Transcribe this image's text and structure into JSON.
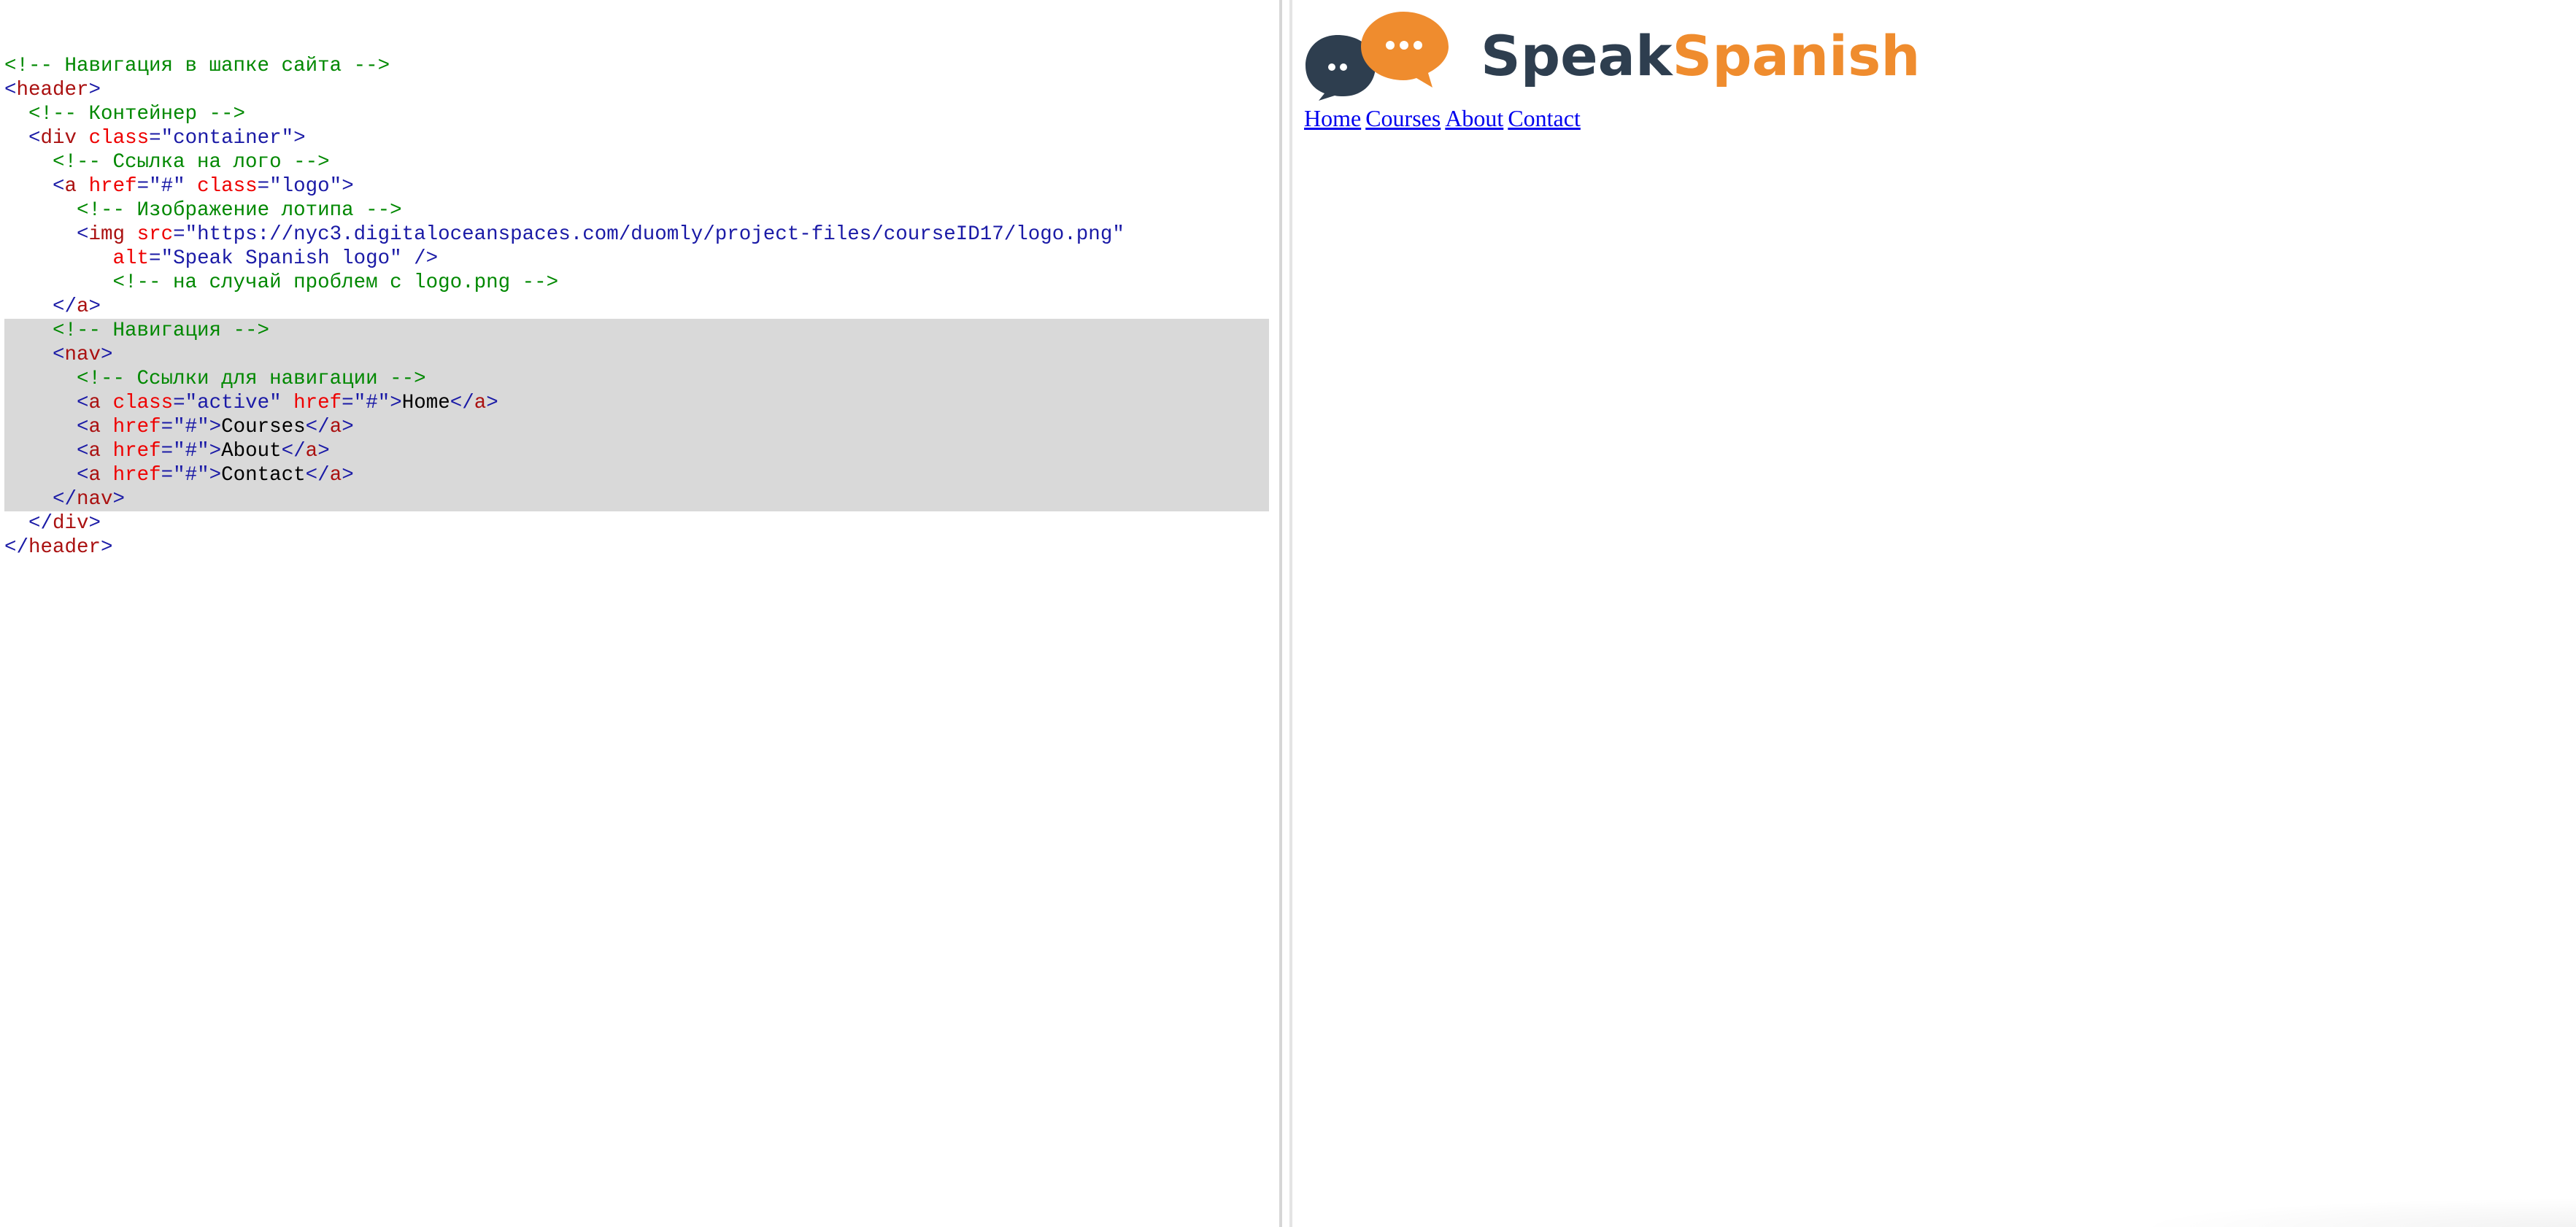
{
  "editor": {
    "lines": [
      {
        "highlight": false,
        "tokens": []
      },
      {
        "highlight": false,
        "tokens": [
          {
            "t": "com",
            "v": "<!-- Навигация в шапке сайта -->"
          }
        ]
      },
      {
        "highlight": false,
        "tokens": [
          {
            "t": "tag",
            "v": "<"
          },
          {
            "t": "name",
            "v": "header"
          },
          {
            "t": "tag",
            "v": ">"
          }
        ]
      },
      {
        "highlight": false,
        "tokens": [
          {
            "t": "txt",
            "v": "  "
          },
          {
            "t": "com",
            "v": "<!-- Контейнер -->"
          }
        ]
      },
      {
        "highlight": false,
        "tokens": [
          {
            "t": "txt",
            "v": "  "
          },
          {
            "t": "tag",
            "v": "<"
          },
          {
            "t": "name",
            "v": "div"
          },
          {
            "t": "txt",
            "v": " "
          },
          {
            "t": "attr",
            "v": "class"
          },
          {
            "t": "tag",
            "v": "="
          },
          {
            "t": "str",
            "v": "\"container\""
          },
          {
            "t": "tag",
            "v": ">"
          }
        ]
      },
      {
        "highlight": false,
        "tokens": [
          {
            "t": "txt",
            "v": "    "
          },
          {
            "t": "com",
            "v": "<!-- Ссылка на лого -->"
          }
        ]
      },
      {
        "highlight": false,
        "tokens": [
          {
            "t": "txt",
            "v": "    "
          },
          {
            "t": "tag",
            "v": "<"
          },
          {
            "t": "name",
            "v": "a"
          },
          {
            "t": "txt",
            "v": " "
          },
          {
            "t": "attr",
            "v": "href"
          },
          {
            "t": "tag",
            "v": "="
          },
          {
            "t": "str",
            "v": "\"#\""
          },
          {
            "t": "txt",
            "v": " "
          },
          {
            "t": "attr",
            "v": "class"
          },
          {
            "t": "tag",
            "v": "="
          },
          {
            "t": "str",
            "v": "\"logo\""
          },
          {
            "t": "tag",
            "v": ">"
          }
        ]
      },
      {
        "highlight": false,
        "tokens": [
          {
            "t": "txt",
            "v": "      "
          },
          {
            "t": "com",
            "v": "<!-- Изображение лотипа -->"
          }
        ]
      },
      {
        "highlight": false,
        "tokens": [
          {
            "t": "txt",
            "v": "      "
          },
          {
            "t": "tag",
            "v": "<"
          },
          {
            "t": "name",
            "v": "img"
          },
          {
            "t": "txt",
            "v": " "
          },
          {
            "t": "attr",
            "v": "src"
          },
          {
            "t": "tag",
            "v": "="
          },
          {
            "t": "str",
            "v": "\"https://nyc3.digitaloceanspaces.com/duomly/project-files/courseID17/logo.png\""
          }
        ]
      },
      {
        "highlight": false,
        "tokens": [
          {
            "t": "txt",
            "v": "         "
          },
          {
            "t": "attr",
            "v": "alt"
          },
          {
            "t": "tag",
            "v": "="
          },
          {
            "t": "str",
            "v": "\"Speak Spanish logo\""
          },
          {
            "t": "txt",
            "v": " "
          },
          {
            "t": "tag",
            "v": "/>"
          }
        ]
      },
      {
        "highlight": false,
        "tokens": [
          {
            "t": "txt",
            "v": "         "
          },
          {
            "t": "com",
            "v": "<!-- на случай проблем с logo.png -->"
          }
        ]
      },
      {
        "highlight": false,
        "tokens": [
          {
            "t": "txt",
            "v": "    "
          },
          {
            "t": "tag",
            "v": "</"
          },
          {
            "t": "name",
            "v": "a"
          },
          {
            "t": "tag",
            "v": ">"
          }
        ]
      },
      {
        "highlight": true,
        "tokens": [
          {
            "t": "txt",
            "v": "    "
          },
          {
            "t": "com",
            "v": "<!-- Навигация -->"
          }
        ]
      },
      {
        "highlight": true,
        "tokens": [
          {
            "t": "txt",
            "v": "    "
          },
          {
            "t": "tag",
            "v": "<"
          },
          {
            "t": "name",
            "v": "nav"
          },
          {
            "t": "tag",
            "v": ">"
          }
        ]
      },
      {
        "highlight": true,
        "tokens": [
          {
            "t": "txt",
            "v": "      "
          },
          {
            "t": "com",
            "v": "<!-- Ссылки для навигации -->"
          }
        ]
      },
      {
        "highlight": true,
        "tokens": [
          {
            "t": "txt",
            "v": "      "
          },
          {
            "t": "tag",
            "v": "<"
          },
          {
            "t": "name",
            "v": "a"
          },
          {
            "t": "txt",
            "v": " "
          },
          {
            "t": "attr",
            "v": "class"
          },
          {
            "t": "tag",
            "v": "="
          },
          {
            "t": "str",
            "v": "\"active\""
          },
          {
            "t": "txt",
            "v": " "
          },
          {
            "t": "attr",
            "v": "href"
          },
          {
            "t": "tag",
            "v": "="
          },
          {
            "t": "str",
            "v": "\"#\""
          },
          {
            "t": "tag",
            "v": ">"
          },
          {
            "t": "txt",
            "v": "Home"
          },
          {
            "t": "tag",
            "v": "</"
          },
          {
            "t": "name",
            "v": "a"
          },
          {
            "t": "tag",
            "v": ">"
          }
        ]
      },
      {
        "highlight": true,
        "tokens": [
          {
            "t": "txt",
            "v": "      "
          },
          {
            "t": "tag",
            "v": "<"
          },
          {
            "t": "name",
            "v": "a"
          },
          {
            "t": "txt",
            "v": " "
          },
          {
            "t": "attr",
            "v": "href"
          },
          {
            "t": "tag",
            "v": "="
          },
          {
            "t": "str",
            "v": "\"#\""
          },
          {
            "t": "tag",
            "v": ">"
          },
          {
            "t": "txt",
            "v": "Courses"
          },
          {
            "t": "tag",
            "v": "</"
          },
          {
            "t": "name",
            "v": "a"
          },
          {
            "t": "tag",
            "v": ">"
          }
        ]
      },
      {
        "highlight": true,
        "tokens": [
          {
            "t": "txt",
            "v": "      "
          },
          {
            "t": "tag",
            "v": "<"
          },
          {
            "t": "name",
            "v": "a"
          },
          {
            "t": "txt",
            "v": " "
          },
          {
            "t": "attr",
            "v": "href"
          },
          {
            "t": "tag",
            "v": "="
          },
          {
            "t": "str",
            "v": "\"#\""
          },
          {
            "t": "tag",
            "v": ">"
          },
          {
            "t": "txt",
            "v": "About"
          },
          {
            "t": "tag",
            "v": "</"
          },
          {
            "t": "name",
            "v": "a"
          },
          {
            "t": "tag",
            "v": ">"
          }
        ]
      },
      {
        "highlight": true,
        "tokens": [
          {
            "t": "txt",
            "v": "      "
          },
          {
            "t": "tag",
            "v": "<"
          },
          {
            "t": "name",
            "v": "a"
          },
          {
            "t": "txt",
            "v": " "
          },
          {
            "t": "attr",
            "v": "href"
          },
          {
            "t": "tag",
            "v": "="
          },
          {
            "t": "str",
            "v": "\"#\""
          },
          {
            "t": "tag",
            "v": ">"
          },
          {
            "t": "txt",
            "v": "Contact"
          },
          {
            "t": "tag",
            "v": "</"
          },
          {
            "t": "name",
            "v": "a"
          },
          {
            "t": "tag",
            "v": ">"
          }
        ]
      },
      {
        "highlight": true,
        "tokens": [
          {
            "t": "txt",
            "v": "    "
          },
          {
            "t": "tag",
            "v": "</"
          },
          {
            "t": "name",
            "v": "nav"
          },
          {
            "t": "tag",
            "v": ">"
          }
        ]
      },
      {
        "highlight": false,
        "tokens": [
          {
            "t": "txt",
            "v": "  "
          },
          {
            "t": "tag",
            "v": "</"
          },
          {
            "t": "name",
            "v": "div"
          },
          {
            "t": "tag",
            "v": ">"
          }
        ]
      },
      {
        "highlight": false,
        "tokens": [
          {
            "t": "tag",
            "v": "</"
          },
          {
            "t": "name",
            "v": "header"
          },
          {
            "t": "tag",
            "v": ">"
          }
        ]
      }
    ]
  },
  "preview": {
    "logo": {
      "alt": "Speak Spanish logo",
      "word_1": "Speak",
      "word_2": "Spanish",
      "color_dark": "#2e3e4f",
      "color_orange": "#ef8c2e",
      "icon": "chat-bubbles-icon"
    },
    "nav": [
      {
        "label": "Home",
        "active": true
      },
      {
        "label": "Courses",
        "active": false
      },
      {
        "label": "About",
        "active": false
      },
      {
        "label": "Contact",
        "active": false
      }
    ]
  },
  "colors": {
    "comment": "#008800",
    "tag": "#1a1aa6",
    "tag_name": "#aa1111",
    "attribute": "#ee0000",
    "string": "#1a1aa6",
    "highlight_bg": "#d9d9d9",
    "link": "#0000ee"
  }
}
